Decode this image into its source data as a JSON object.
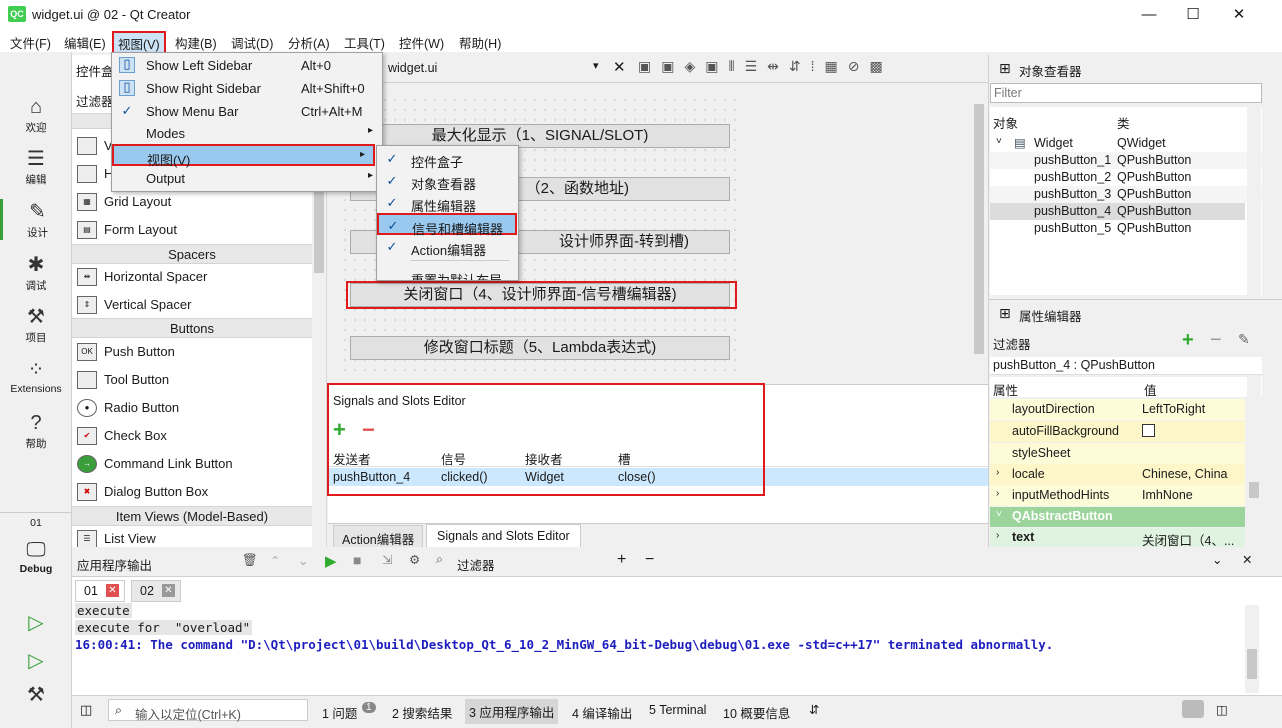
{
  "window": {
    "title": "widget.ui @ 02 - Qt Creator",
    "logo": "QC",
    "controls": [
      "—",
      "☐",
      "✕"
    ]
  },
  "menubar": [
    "文件(F)",
    "编辑(E)",
    "视图(V)",
    "构建(B)",
    "调试(D)",
    "分析(A)",
    "工具(T)",
    "控件(W)",
    "帮助(H)"
  ],
  "modes": [
    {
      "label": "欢迎",
      "icon": "home-icon"
    },
    {
      "label": "编辑",
      "icon": "edit-icon"
    },
    {
      "label": "设计",
      "icon": "design-icon"
    },
    {
      "label": "调试",
      "icon": "bug-icon"
    },
    {
      "label": "项目",
      "icon": "wrench-icon"
    },
    {
      "label": "Extensions",
      "icon": "extensions-icon"
    },
    {
      "label": "帮助",
      "icon": "help-icon"
    }
  ],
  "kit": {
    "name": "01",
    "label": "Debug"
  },
  "widgetbox": {
    "title": "控件盒",
    "filter": "过滤器",
    "partial": [
      "V",
      "H"
    ],
    "layouts": [
      "Grid Layout",
      "Form Layout"
    ],
    "spacers_cat": "Spacers",
    "spacers": [
      "Horizontal Spacer",
      "Vertical Spacer"
    ],
    "buttons_cat": "Buttons",
    "buttons": [
      "Push Button",
      "Tool Button",
      "Radio Button",
      "Check Box",
      "Command Link Button",
      "Dialog Button Box"
    ],
    "itemviews_cat": "Item Views (Model-Based)",
    "itemviews": [
      "List View"
    ]
  },
  "view_menu": {
    "items": [
      {
        "label": "Show Left Sidebar",
        "shortcut": "Alt+0",
        "check": "box"
      },
      {
        "label": "Show Right Sidebar",
        "shortcut": "Alt+Shift+0",
        "check": "box"
      },
      {
        "label": "Show Menu Bar",
        "shortcut": "Ctrl+Alt+M",
        "check": "✓"
      },
      {
        "label": "Modes",
        "submenu": true
      },
      {
        "label": "视图(V)",
        "submenu": true
      },
      {
        "label": "Output",
        "submenu": true
      }
    ]
  },
  "sub_menu": {
    "items": [
      {
        "label": "控件盒子",
        "check": "✓"
      },
      {
        "label": "对象查看器",
        "check": "✓"
      },
      {
        "label": "属性编辑器",
        "check": "✓"
      },
      {
        "label": "信号和槽编辑器",
        "check": "✓"
      },
      {
        "label": "Action编辑器",
        "check": "✓"
      },
      {
        "label": "重置为默认布局",
        "check": ""
      }
    ]
  },
  "editor": {
    "tab": "widget.ui",
    "buttons": [
      "最大化显示（1、SIGNAL/SLOT)",
      "（2、函数地址)",
      "设计师界面-转到槽)",
      "关闭窗口（4、设计师界面-信号槽编辑器)",
      "修改窗口标题（5、Lambda表达式)"
    ]
  },
  "sse": {
    "title": "Signals and Slots Editor",
    "headers": [
      "发送者",
      "信号",
      "接收者",
      "槽"
    ],
    "rows": [
      [
        "pushButton_4",
        "clicked()",
        "Widget",
        "close()"
      ]
    ],
    "tabs": [
      "Action编辑器",
      "Signals and Slots Editor"
    ]
  },
  "inspector": {
    "title": "对象查看器",
    "filter_placeholder": "Filter",
    "headers": [
      "对象",
      "类"
    ],
    "rows": [
      [
        "Widget",
        "QWidget"
      ],
      [
        "pushButton_1",
        "QPushButton"
      ],
      [
        "pushButton_2",
        "QPushButton"
      ],
      [
        "pushButton_3",
        "QPushButton"
      ],
      [
        "pushButton_4",
        "QPushButton"
      ],
      [
        "pushButton_5",
        "QPushButton"
      ]
    ]
  },
  "property": {
    "title": "属性编辑器",
    "filter": "过滤器",
    "object": "pushButton_4 : QPushButton",
    "headers": [
      "属性",
      "值"
    ],
    "rows": [
      [
        "layoutDirection",
        "LeftToRight"
      ],
      [
        "autoFillBackground",
        ""
      ],
      [
        "styleSheet",
        ""
      ],
      [
        "locale",
        "Chinese, China"
      ],
      [
        "inputMethodHints",
        "ImhNone"
      ]
    ],
    "section": "QAbstractButton",
    "text_row": [
      "text",
      "关闭窗口（4、..."
    ]
  },
  "output": {
    "title": "应用程序输出",
    "filter": "过滤器",
    "tabs": [
      "01",
      "02"
    ],
    "lines": [
      "execute",
      "execute for  \"overload\""
    ],
    "terminated": "16:00:41: The command \"D:\\Qt\\project\\01\\build\\Desktop_Qt_6_10_2_MinGW_64_bit-Debug\\debug\\01.exe -std=c++17\" terminated abnormally."
  },
  "statusbar": {
    "locate": "输入以定位(Ctrl+K)",
    "items": [
      "1 问题",
      "2 搜索结果",
      "3 应用程序输出",
      "4 编译输出",
      "5 Terminal",
      "10 概要信息"
    ],
    "issues_count": "1"
  }
}
